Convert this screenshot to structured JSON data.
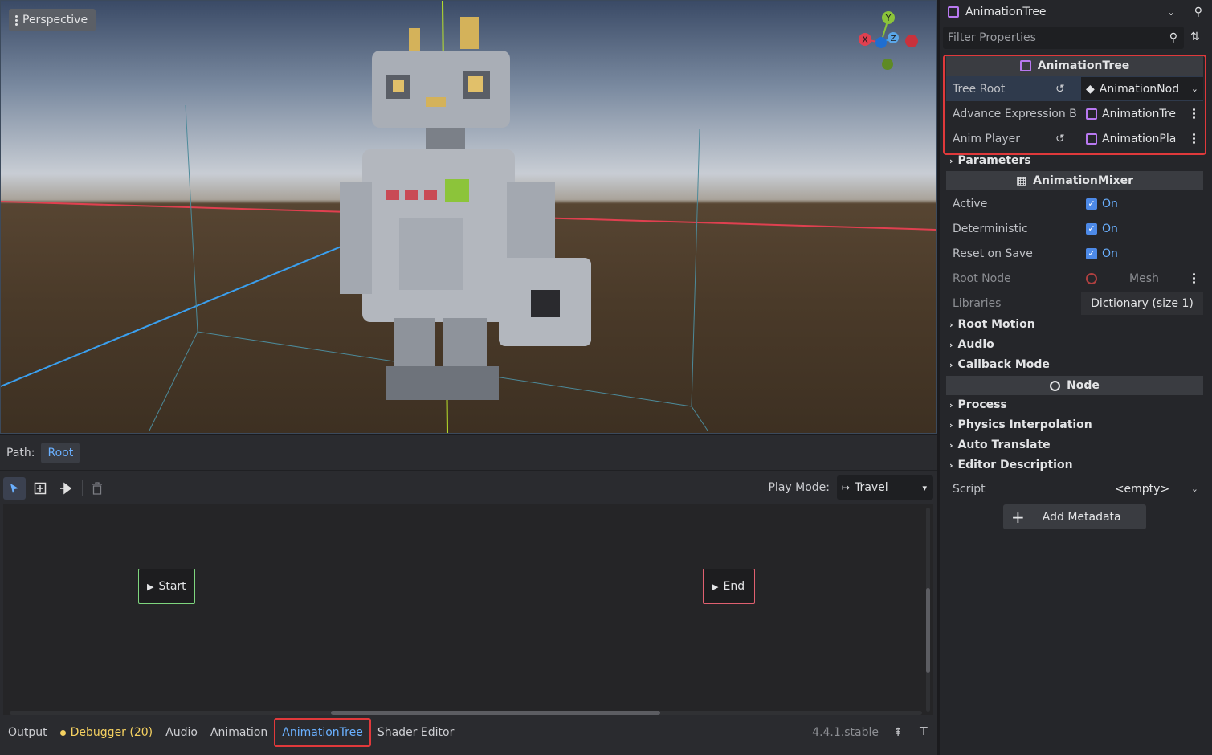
{
  "viewport": {
    "mode_label": "Perspective",
    "gizmo": {
      "x": "X",
      "y": "Y",
      "z": "Z"
    }
  },
  "bottom": {
    "path_label": "Path:",
    "path_value": "Root",
    "play_mode_label": "Play Mode:",
    "play_mode_value": "Travel",
    "nodes": {
      "start": "Start",
      "end": "End"
    },
    "tabs": [
      "Output",
      "Debugger (20)",
      "Audio",
      "Animation",
      "AnimationTree",
      "Shader Editor"
    ],
    "version": "4.4.1.stable"
  },
  "inspector": {
    "node_name": "AnimationTree",
    "filter_placeholder": "Filter Properties",
    "section_animationtree": "AnimationTree",
    "tree_root_label": "Tree Root",
    "tree_root_value": "AnimationNod",
    "adv_expr_label": "Advance Expression B",
    "adv_expr_value": "AnimationTre",
    "anim_player_label": "Anim Player",
    "anim_player_value": "AnimationPla",
    "parameters": "Parameters",
    "section_mixer": "AnimationMixer",
    "active_label": "Active",
    "active_value": "On",
    "deterministic_label": "Deterministic",
    "deterministic_value": "On",
    "reset_label": "Reset on Save",
    "reset_value": "On",
    "root_node_label": "Root Node",
    "root_node_value": "Mesh",
    "libraries_label": "Libraries",
    "libraries_value": "Dictionary (size 1)",
    "root_motion": "Root Motion",
    "audio": "Audio",
    "callback_mode": "Callback Mode",
    "section_node": "Node",
    "process": "Process",
    "physics_interp": "Physics Interpolation",
    "auto_translate": "Auto Translate",
    "editor_desc": "Editor Description",
    "script_label": "Script",
    "script_value": "<empty>",
    "add_metadata": "Add Metadata"
  }
}
